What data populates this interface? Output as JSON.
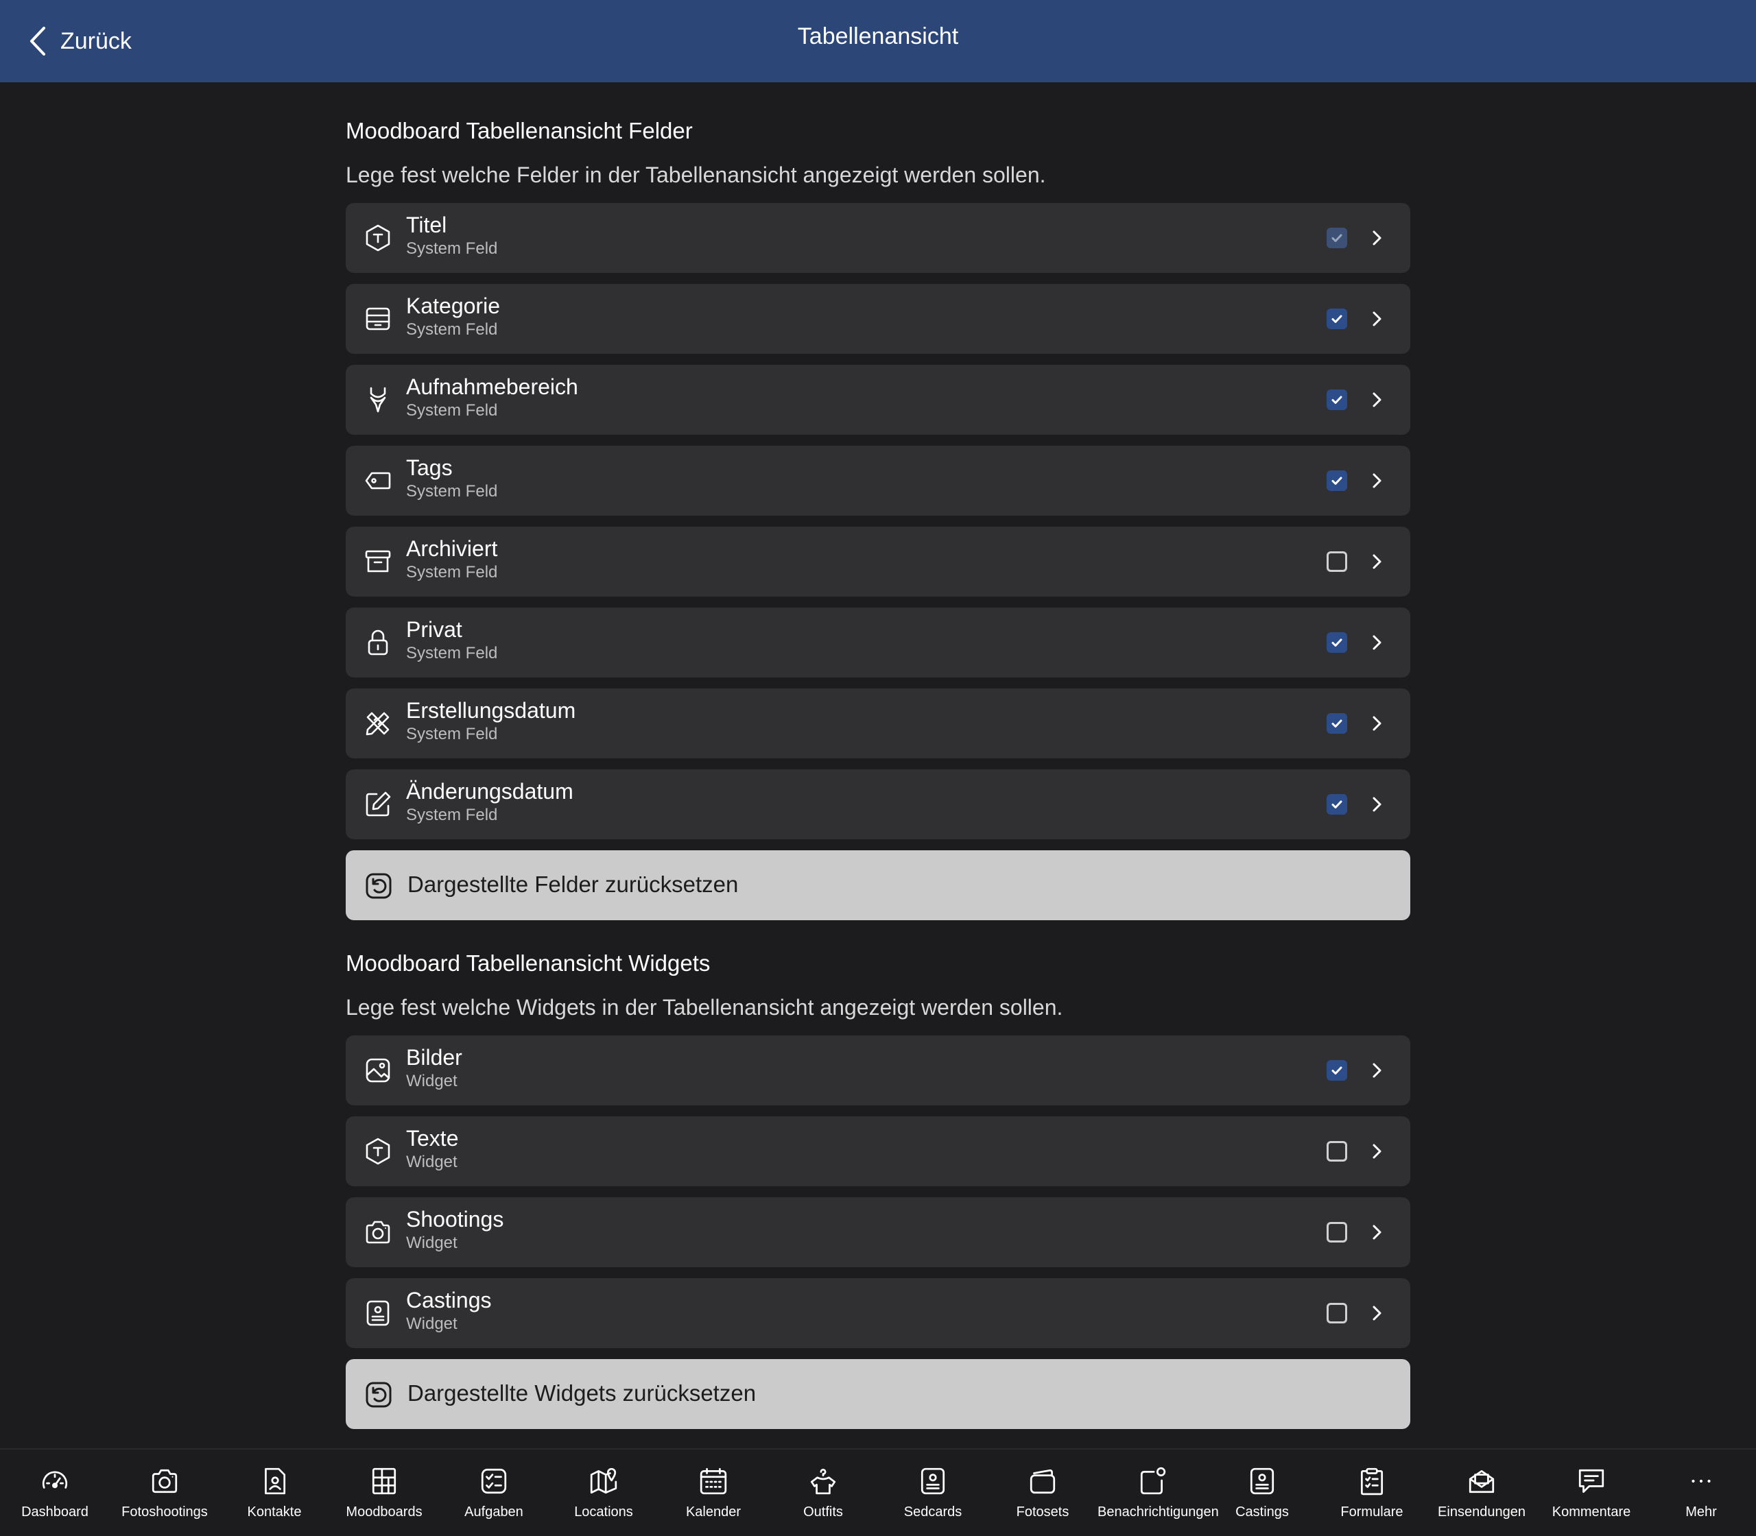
{
  "header": {
    "back_label": "Zurück",
    "title": "Tabellenansicht",
    "bg_color": "#2c4677"
  },
  "fields_section": {
    "title": "Moodboard Tabellenansicht Felder",
    "description": "Lege fest welche Felder in der Tabellenansicht angezeigt werden sollen.",
    "items": [
      {
        "label": "Titel",
        "sub": "System Feld",
        "icon": "text-badge-icon",
        "checked": true,
        "disabled": true
      },
      {
        "label": "Kategorie",
        "sub": "System Feld",
        "icon": "inbox-tray-icon",
        "checked": true
      },
      {
        "label": "Aufnahmebereich",
        "sub": "System Feld",
        "icon": "body-figure-icon",
        "checked": true
      },
      {
        "label": "Tags",
        "sub": "System Feld",
        "icon": "tag-icon",
        "checked": true
      },
      {
        "label": "Archiviert",
        "sub": "System Feld",
        "icon": "archive-box-icon",
        "checked": false
      },
      {
        "label": "Privat",
        "sub": "System Feld",
        "icon": "lock-icon",
        "checked": true
      },
      {
        "label": "Erstellungsdatum",
        "sub": "System Feld",
        "icon": "pencil-ruler-icon",
        "checked": true
      },
      {
        "label": "Änderungsdatum",
        "sub": "System Feld",
        "icon": "edit-square-icon",
        "checked": true
      }
    ],
    "reset_label": "Dargestellte Felder zurücksetzen"
  },
  "widgets_section": {
    "title": "Moodboard Tabellenansicht Widgets",
    "description": "Lege fest welche Widgets in der Tabellenansicht angezeigt werden sollen.",
    "items": [
      {
        "label": "Bilder",
        "sub": "Widget",
        "icon": "image-icon",
        "checked": true
      },
      {
        "label": "Texte",
        "sub": "Widget",
        "icon": "text-badge-icon",
        "checked": false
      },
      {
        "label": "Shootings",
        "sub": "Widget",
        "icon": "camera-icon",
        "checked": false
      },
      {
        "label": "Castings",
        "sub": "Widget",
        "icon": "id-card-icon",
        "checked": false
      }
    ],
    "reset_label": "Dargestellte Widgets zurücksetzen"
  },
  "tabbar": [
    {
      "label": "Dashboard",
      "icon": "speedometer-icon"
    },
    {
      "label": "Fotoshootings",
      "icon": "camera-icon"
    },
    {
      "label": "Kontakte",
      "icon": "contact-file-icon"
    },
    {
      "label": "Moodboards",
      "icon": "moodboard-grid-icon"
    },
    {
      "label": "Aufgaben",
      "icon": "checklist-icon"
    },
    {
      "label": "Locations",
      "icon": "map-pin-icon"
    },
    {
      "label": "Kalender",
      "icon": "calendar-icon"
    },
    {
      "label": "Outfits",
      "icon": "shirt-hanger-icon"
    },
    {
      "label": "Sedcards",
      "icon": "id-card-icon"
    },
    {
      "label": "Fotosets",
      "icon": "photo-stack-icon"
    },
    {
      "label": "Benachrichtigungen",
      "icon": "notification-icon"
    },
    {
      "label": "Castings",
      "icon": "id-card-icon"
    },
    {
      "label": "Formulare",
      "icon": "clipboard-icon"
    },
    {
      "label": "Einsendungen",
      "icon": "mail-open-icon"
    },
    {
      "label": "Kommentare",
      "icon": "comment-icon"
    },
    {
      "label": "Mehr",
      "icon": "more-dots-icon"
    }
  ],
  "colors": {
    "background": "#1c1c1e",
    "row": "#303032",
    "checkbox_on": "#2c4d8a",
    "reset_button": "#cbcbcb"
  }
}
